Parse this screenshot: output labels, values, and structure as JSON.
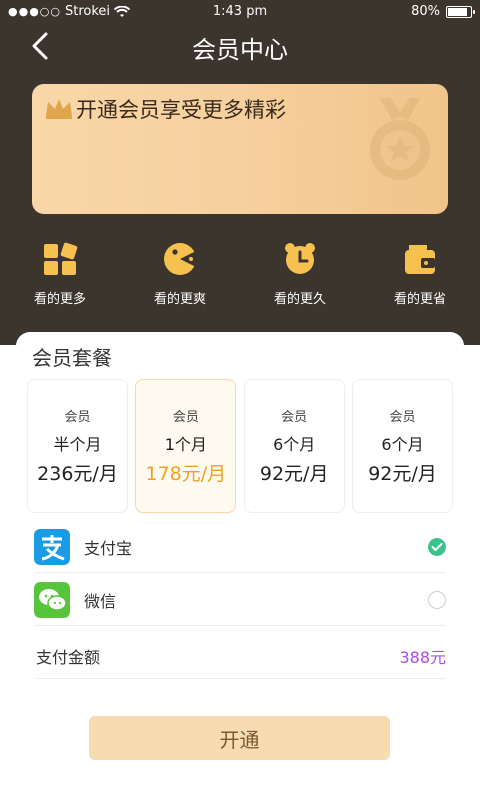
{
  "status_bar": {
    "signal": "●●●○○",
    "carrier": "Strokei",
    "time": "1:43 pm",
    "battery": "80%"
  },
  "header": {
    "title": "会员中心"
  },
  "banner": {
    "text": "开通会员享受更多精彩"
  },
  "features": [
    {
      "label": "看的更多",
      "icon": "grid-icon"
    },
    {
      "label": "看的更爽",
      "icon": "smile-icon"
    },
    {
      "label": "看的更久",
      "icon": "alarm-clock-icon"
    },
    {
      "label": "看的更省",
      "icon": "wallet-icon"
    }
  ],
  "plans_section": {
    "title": "会员套餐",
    "plans": [
      {
        "tag": "会员",
        "duration": "半个月",
        "price": "236元/月"
      },
      {
        "tag": "会员",
        "duration": "1个月",
        "price": "178元/月"
      },
      {
        "tag": "会员",
        "duration": "6个月",
        "price": "92元/月"
      },
      {
        "tag": "会员",
        "duration": "6个月",
        "price": "92元/月"
      }
    ],
    "selected_index": 1
  },
  "payment": {
    "methods": [
      {
        "label": "支付宝",
        "icon": "alipay-icon",
        "selected": true
      },
      {
        "label": "微信",
        "icon": "wechat-icon",
        "selected": false
      }
    ],
    "amount_label": "支付金额",
    "amount_value": "388元"
  },
  "actions": {
    "submit_label": "开通"
  },
  "colors": {
    "header_bg": "#3b352d",
    "accent_gold": "#f0a020",
    "amount_purple": "#b04be2",
    "alipay_blue": "#1a9be6",
    "wechat_green": "#58c43b",
    "check_green": "#39c28a"
  }
}
